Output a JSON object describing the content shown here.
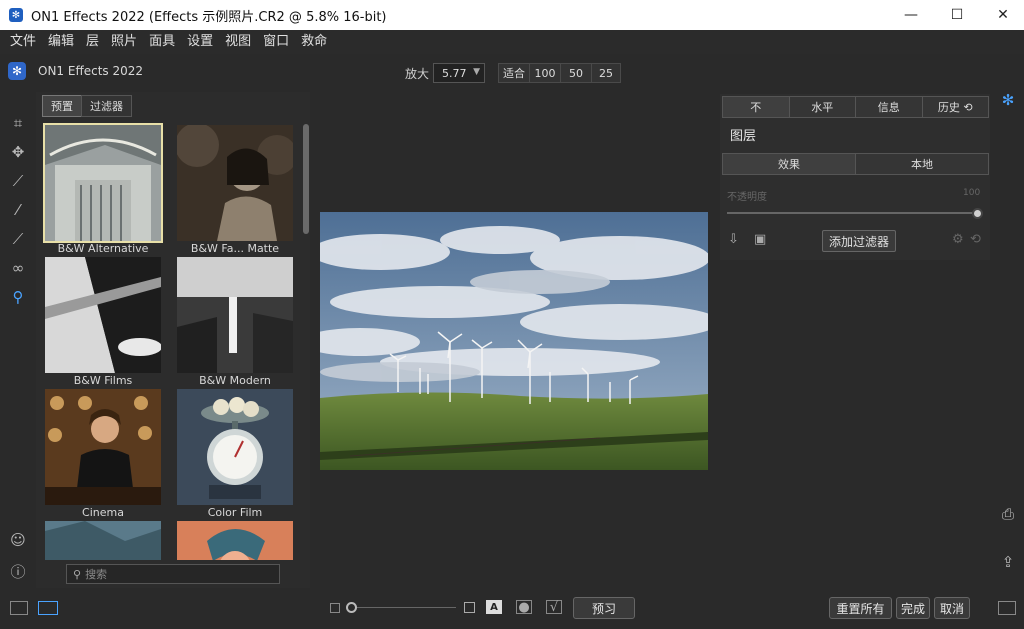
{
  "window": {
    "title": "ON1 Effects 2022 (Effects 示例照片.CR2 @ 5.8% 16-bit)",
    "minimize_glyph": "—",
    "maximize_glyph": "☐",
    "close_glyph": "✕"
  },
  "menu": [
    "文件",
    "编辑",
    "层",
    "照片",
    "面具",
    "设置",
    "视图",
    "窗口",
    "救命"
  ],
  "brand": {
    "name": "ON1 Effects 2022"
  },
  "zoom": {
    "label": "放大",
    "value": "5.77"
  },
  "fit_buttons": [
    "适合",
    "100",
    "50",
    "25"
  ],
  "browser": {
    "tabs": [
      "预置",
      "过滤器"
    ],
    "items": [
      {
        "caption": "B&W Alternative"
      },
      {
        "caption": "B&W Fa... Matte"
      },
      {
        "caption": "B&W Films"
      },
      {
        "caption": "B&W Modern"
      },
      {
        "caption": "Cinema"
      },
      {
        "caption": "Color Film"
      },
      {
        "caption": ""
      },
      {
        "caption": ""
      }
    ],
    "search_placeholder": "搜索"
  },
  "right_panel": {
    "tabs": [
      "不",
      "水平",
      "信息",
      "历史 ⟲"
    ],
    "layers_title": "图层",
    "subtabs": [
      "效果",
      "本地"
    ],
    "opacity_label": "不透明度",
    "opacity_value": "100",
    "opacity_fraction": 1.0,
    "add_filter": "添加过滤器"
  },
  "bottom": {
    "preview": "预习",
    "reset_all": "重置所有",
    "done": "完成",
    "cancel": "取消",
    "text_tool_glyph": "A"
  },
  "colors": {
    "accent": "#4aa3ff",
    "brand": "#2f67c9",
    "selected_thumb_outline": "#e8e0a8"
  },
  "icons": {
    "tools": [
      "crop-icon",
      "move-icon",
      "brush-icon",
      "masking-brush-icon",
      "refine-brush-icon",
      "retouch-icon",
      "zoom-icon"
    ]
  }
}
